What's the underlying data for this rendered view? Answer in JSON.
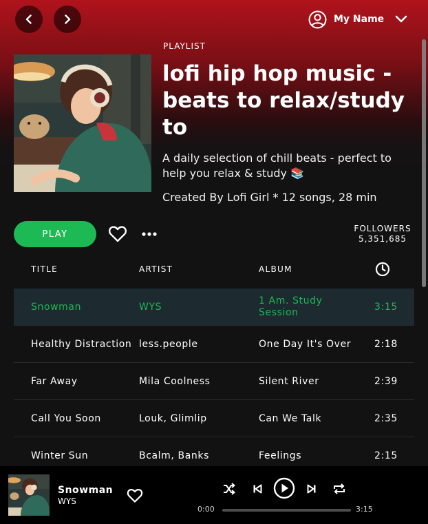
{
  "user": {
    "name": "My Name"
  },
  "playlist": {
    "label": "PLAYLIST",
    "title": "lofi hip hop music - beats to relax/study to",
    "description": "A daily selection of chill beats - perfect to help you relax & study 📚",
    "meta": "Created By Lofi Girl * 12 songs, 28 min"
  },
  "actions": {
    "play_label": "PLAY"
  },
  "followers": {
    "label": "FOLLOWERS",
    "count": "5,351,685"
  },
  "table": {
    "headers": {
      "title": "TITLE",
      "artist": "ARTIST",
      "album": "ALBUM"
    },
    "rows": [
      {
        "title": "Snowman",
        "artist": "WYS",
        "album": "1 Am. Study Session",
        "duration": "3:15"
      },
      {
        "title": "Healthy Distraction",
        "artist": "less.people",
        "album": "One Day It's Over",
        "duration": "2:18"
      },
      {
        "title": "Far Away",
        "artist": "Mila Coolness",
        "album": "Silent River",
        "duration": "2:39"
      },
      {
        "title": "Call You Soon",
        "artist": "Louk, Glimlip",
        "album": "Can We Talk",
        "duration": "2:35"
      },
      {
        "title": "Winter Sun",
        "artist": "Bcalm, Banks",
        "album": "Feelings",
        "duration": "2:15"
      }
    ]
  },
  "player": {
    "title": "Snowman",
    "artist": "WYS",
    "current_time": "0:00",
    "total_time": "3:15",
    "progress": 0
  },
  "colors": {
    "accent": "#1db954",
    "header_red": "#b0131c",
    "background": "#121212"
  }
}
